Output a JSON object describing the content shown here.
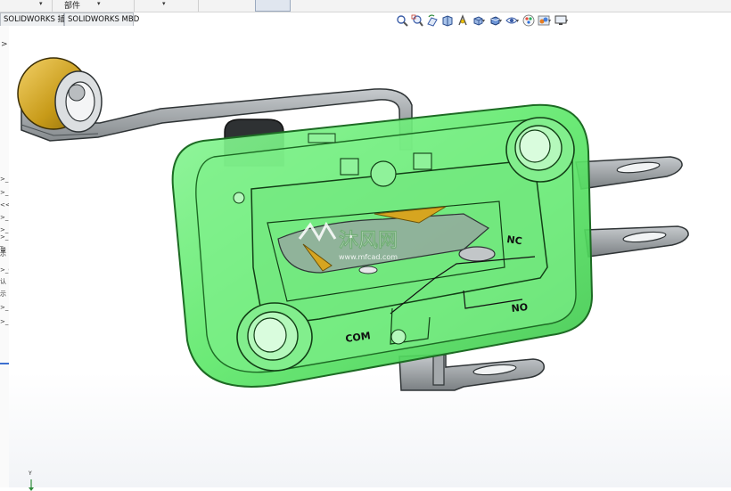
{
  "topbar": {
    "part_label": "部件",
    "dropdown_glyph": "▾"
  },
  "tabs": [
    {
      "label": "SOLIDWORKS 插件"
    },
    {
      "label": "SOLIDWORKS MBD"
    }
  ],
  "left_panel": {
    "expand_glyph": ">",
    "fragments": [
      ">_",
      ">_",
      "<<",
      ">_",
      ">_",
      ">_",
      "_量",
      "示",
      ">_0",
      "认",
      "示",
      ">_",
      ">_"
    ]
  },
  "heads_up_toolbar": {
    "icons": [
      "zoom-to-fit-icon",
      "zoom-area-icon",
      "previous-view-icon",
      "section-view-icon",
      "dynamic-annotation-icon",
      "view-orientation-icon",
      "display-style-icon",
      "hide-show-items-icon",
      "edit-appearance-icon",
      "apply-scene-icon",
      "view-settings-icon"
    ]
  },
  "model": {
    "labels": {
      "nc": "NC",
      "no": "NO",
      "com": "COM"
    },
    "colors": {
      "housing": "#5fe86b",
      "housing_edge": "#1d6b24",
      "lever": "#8f9496",
      "roller": "#c79a18",
      "actuator": "#333333"
    }
  },
  "watermark": {
    "logo": "沐风网",
    "url": "www.mfcad.com"
  },
  "triad": {
    "y_label": "Y"
  }
}
